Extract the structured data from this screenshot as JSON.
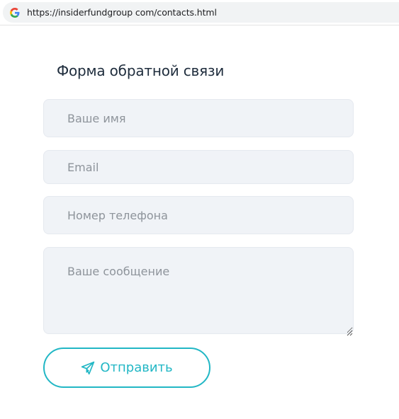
{
  "browser": {
    "url": "https://insiderfundgroup com/contacts.html",
    "favicon_icon": "google-g-icon"
  },
  "form": {
    "title": "Форма обратной связи",
    "fields": {
      "name_placeholder": "Ваше имя",
      "email_placeholder": "Email",
      "phone_placeholder": "Номер телефона",
      "message_placeholder": "Ваше сообщение"
    },
    "submit": {
      "label": "Отправить",
      "icon": "paper-plane-icon"
    }
  },
  "colors": {
    "accent": "#22b7c5",
    "field_bg": "#f0f3f7",
    "title_text": "#1f2d3d",
    "placeholder_text": "#8e949b"
  }
}
